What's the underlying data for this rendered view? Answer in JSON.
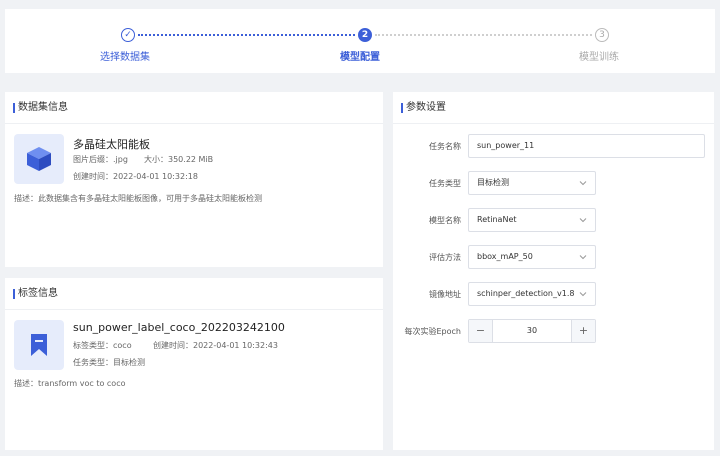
{
  "stepper": {
    "steps": [
      {
        "label": "选择数据集",
        "marker": "✓"
      },
      {
        "label": "模型配置",
        "marker": "2"
      },
      {
        "label": "模型训练",
        "marker": "3"
      }
    ]
  },
  "dataset": {
    "title": "数据集信息",
    "name": "多晶硅太阳能板",
    "format_label": "图片后缀：",
    "format": ".jpg",
    "size_label": "大小：",
    "size": "350.22 MiB",
    "created_label": "创建时间：",
    "created": "2022-04-01 10:32:18",
    "description": "描述：此数据集含有多晶硅太阳能板图像，可用于多晶硅太阳能板检测",
    "icon": "cube-icon"
  },
  "label": {
    "title": "标签信息",
    "name": "sun_power_label_coco_202203242100",
    "type_label": "标签类型：",
    "type": "coco",
    "created_label": "创建时间：",
    "created": "2022-04-01 10:32:43",
    "task_label": "任务类型：",
    "task": "目标检测",
    "description": "描述：transform voc to coco",
    "icon": "bookmark-icon"
  },
  "params": {
    "title": "参数设置",
    "task_name_label": "任务名称",
    "task_name_value": "sun_power_11",
    "task_type_label": "任务类型",
    "task_type_value": "目标检测",
    "model_name_label": "模型名称",
    "model_name_value": "RetinaNet",
    "eval_label": "评估方法",
    "eval_value": "bbox_mAP_50",
    "image_label": "镜像地址",
    "image_value": "schinper_detection_v1.8",
    "epoch_label": "每次实验Epoch",
    "epoch_value": "30",
    "minus": "−",
    "plus": "+"
  },
  "colors": {
    "accent": "#3c5fd8",
    "inactive": "#aaaaaa"
  }
}
